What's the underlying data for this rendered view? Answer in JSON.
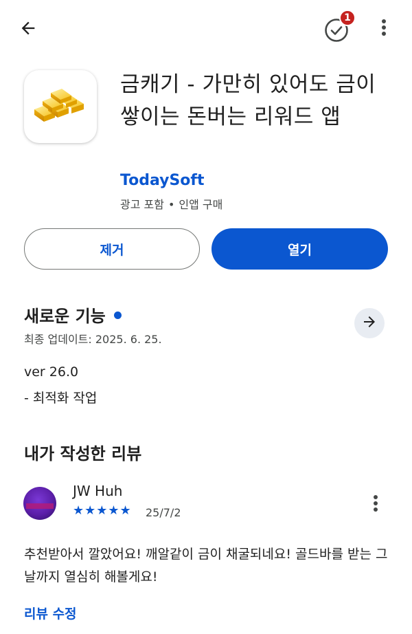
{
  "topbar": {
    "back_icon": "arrow-left-icon",
    "updates_icon": "check-circle-icon",
    "updates_badge": "1",
    "more_icon": "more-vertical-icon"
  },
  "app": {
    "title": "금캐기 - 가만히 있어도 금이 쌓이는 돈버는 리워드 앱",
    "icon": "gold-bars-icon",
    "developer": "TodaySoft",
    "meta_ads": "광고 포함",
    "meta_separator": "•",
    "meta_iap": "인앱 구매"
  },
  "actions": {
    "uninstall_label": "제거",
    "open_label": "열기"
  },
  "whats_new": {
    "title": "새로운 기능",
    "updated": "최종 업데이트: 2025. 6. 25.",
    "version": "ver 26.0",
    "note": "- 최적화 작업",
    "arrow_icon": "arrow-right-icon"
  },
  "my_review": {
    "title": "내가 작성한 리뷰",
    "reviewer": "JW Huh",
    "rating": 5,
    "stars": "★★★★★",
    "date": "25/7/2",
    "text": "추천받아서 깔았어요! 깨알같이 금이 채굴되네요! 골드바를 받는 그날까지 열심히 해볼게요!",
    "edit_label": "리뷰 수정"
  },
  "colors": {
    "accent": "#0b57d0",
    "badge": "#c5221f",
    "text": "#1f1f1f",
    "secondary": "#444746"
  }
}
